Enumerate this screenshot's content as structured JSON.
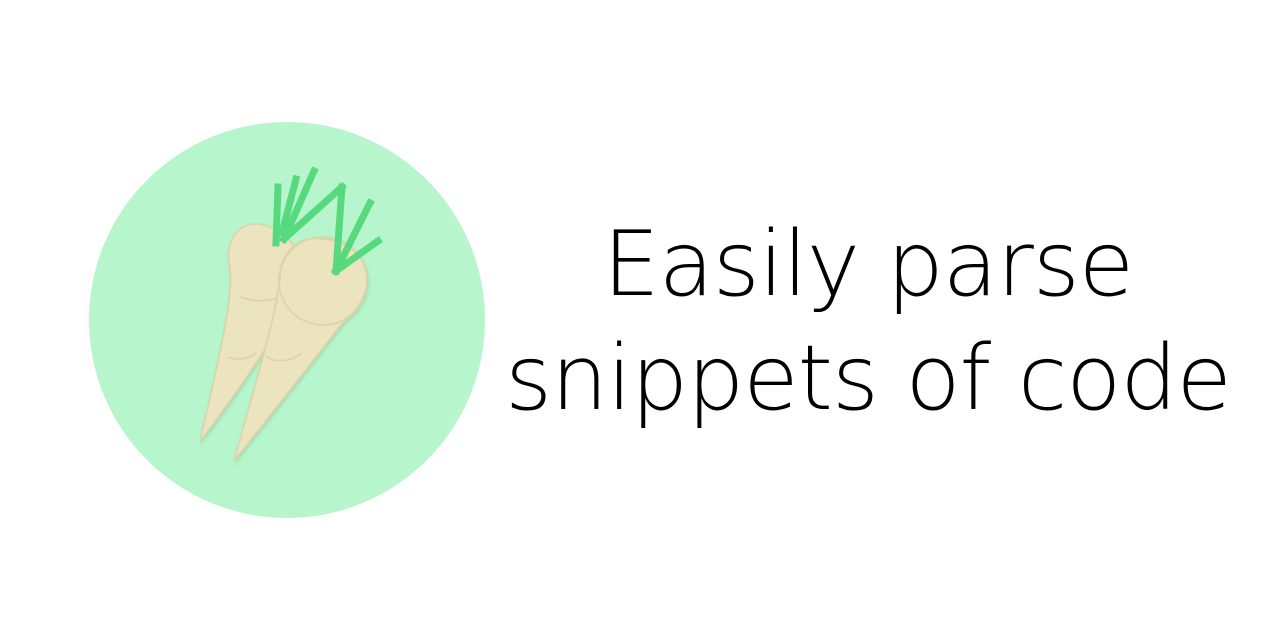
{
  "tagline": {
    "line1": "Easily parse",
    "line2": "snippets of code"
  },
  "logo": {
    "icon": "parsnip-icon",
    "circle_color": "#b7f5cc",
    "root_color": "#ece3bf",
    "leaf_color": "#57d97e"
  }
}
